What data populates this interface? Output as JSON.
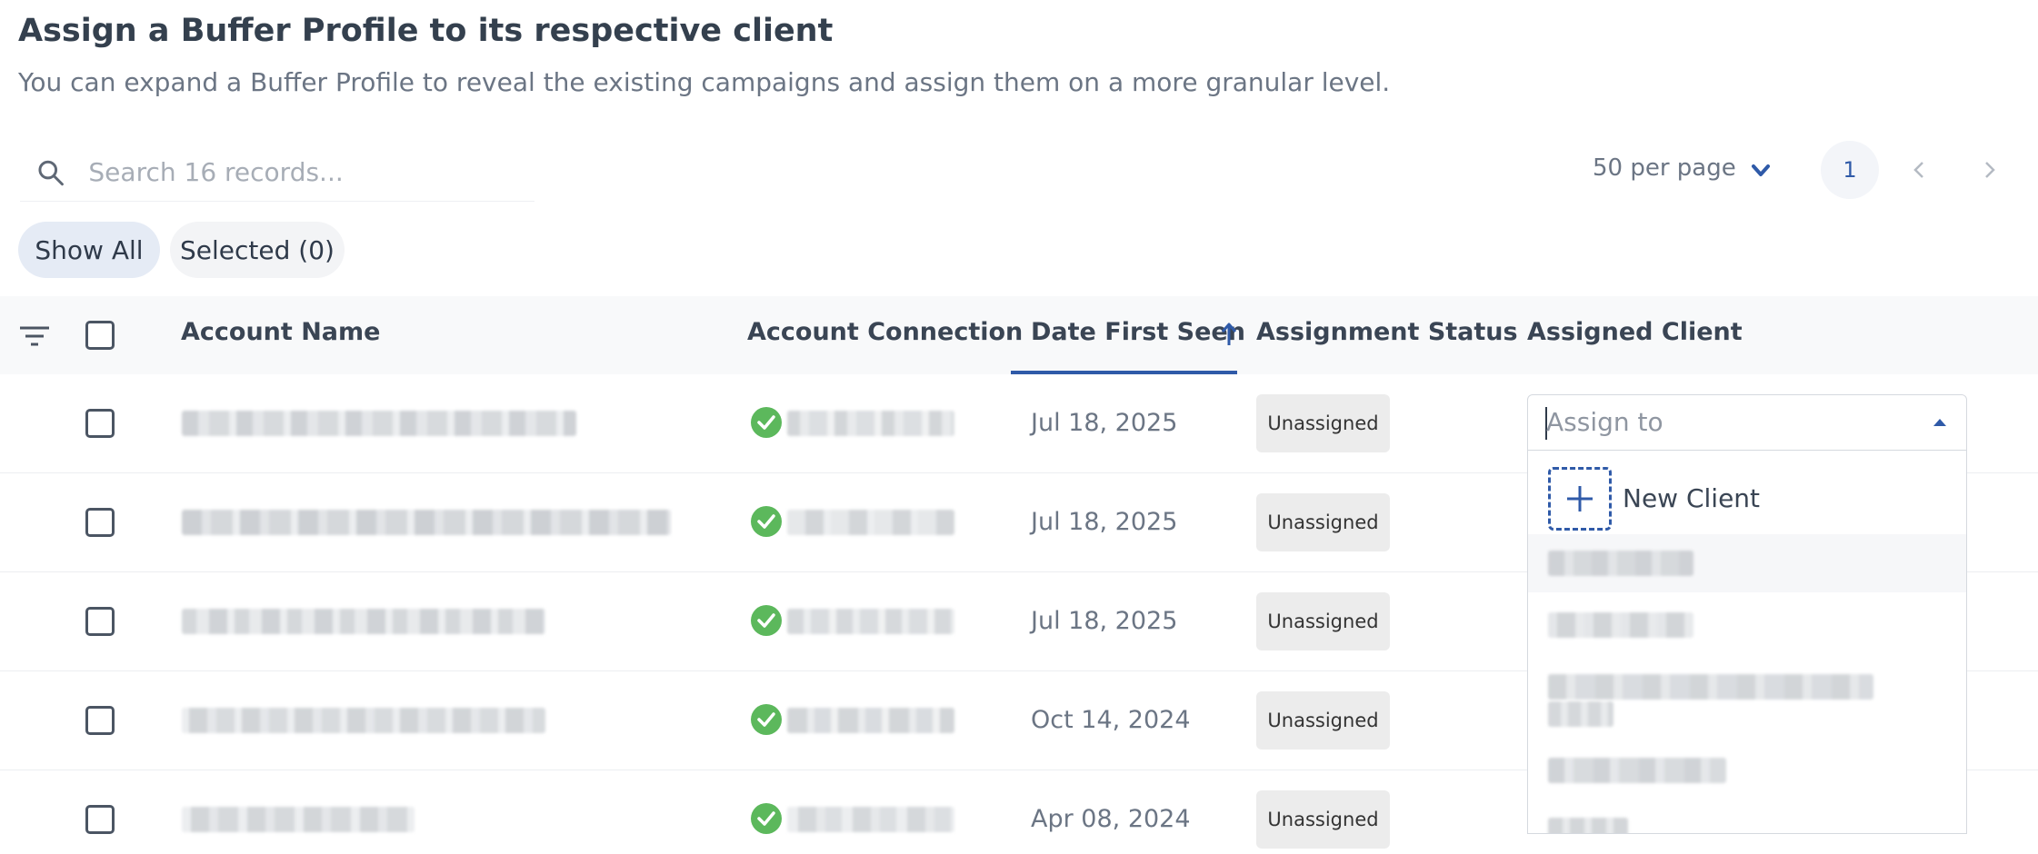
{
  "header": {
    "title": "Assign a Buffer Profile to its respective client",
    "subtitle": "You can expand a Buffer Profile to reveal the existing campaigns and assign them on a more granular level."
  },
  "search": {
    "placeholder": "Search 16 records..."
  },
  "pagination": {
    "per_page_label": "50 per page",
    "current_page": "1"
  },
  "filters": {
    "show_all": "Show All",
    "selected": "Selected (0)"
  },
  "columns": {
    "account_name": "Account Name",
    "account_connection": "Account Connection",
    "date_first_seen": "Date First Seen",
    "assignment_status": "Assignment Status",
    "assigned_client": "Assigned Client"
  },
  "rows": [
    {
      "date": "Jul 18, 2025",
      "status": "Unassigned"
    },
    {
      "date": "Jul 18, 2025",
      "status": "Unassigned"
    },
    {
      "date": "Jul 18, 2025",
      "status": "Unassigned"
    },
    {
      "date": "Oct 14, 2024",
      "status": "Unassigned"
    },
    {
      "date": "Apr 08, 2024",
      "status": "Unassigned"
    }
  ],
  "assign_dropdown": {
    "placeholder": "Assign to",
    "new_client_label": "New Client"
  },
  "colors": {
    "accent": "#2f5aa8",
    "success": "#5cb85c",
    "badge_bg": "#ececec"
  }
}
